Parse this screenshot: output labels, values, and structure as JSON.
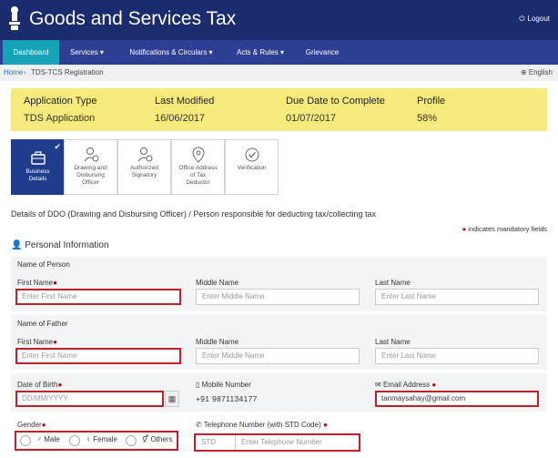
{
  "header": {
    "title": "Goods and Services Tax",
    "logout": "Logout"
  },
  "nav": {
    "items": [
      "Dashboard",
      "Services ▾",
      "Notifications & Circulars ▾",
      "Acts & Rules ▾",
      "Grievance"
    ]
  },
  "breadcrumb": {
    "home": "Home",
    "sep": "›",
    "current": "TDS-TCS Registration",
    "language": "English"
  },
  "info": {
    "headers": [
      "Application Type",
      "Last Modified",
      "Due Date to Complete",
      "Profile"
    ],
    "values": [
      "TDS Application",
      "16/06/2017",
      "01/07/2017",
      "58%"
    ]
  },
  "steps": {
    "s0": {
      "line1": "Business",
      "line2": "Details"
    },
    "s1": {
      "line1": "Drawing and",
      "line2": "Disbursing",
      "line3": "Officer"
    },
    "s2": {
      "line1": "Authorized",
      "line2": "Signatory"
    },
    "s3": {
      "line1": "Office Address",
      "line2": "of Tax",
      "line3": "Deductor"
    },
    "s4": {
      "line1": "Verification"
    }
  },
  "page": {
    "description": "Details of DDO (Drawing and Disbursing Officer) / Person responsible for deducting tax/collecting tax",
    "mandatory_note": "indicates mandatory fields",
    "section_title": "Personal Information"
  },
  "form": {
    "name_of_person": "Name of Person",
    "name_of_father": "Name of Father",
    "first_name_label": "First Name",
    "middle_name_label": "Middle Name",
    "last_name_label": "Last Name",
    "first_name_ph": "Enter First Name",
    "middle_name_ph": "Enter Middle Name",
    "last_name_ph": "Enter Last Name",
    "dob_label": "Date of Birth",
    "dob_ph": "DD/MM/YYYY",
    "mobile_label": "Mobile Number",
    "mobile_value": "+91 9871134177",
    "email_label": "Email Address",
    "email_value": "tanmaysahay@gmail.com",
    "gender_label": "Gender",
    "gender_options": [
      "Male",
      "Female",
      "Others"
    ],
    "tel_label": "Telephone Number (with STD Code)",
    "tel_std_ph": "STD",
    "tel_num_ph": "Enter Telephone Number"
  }
}
